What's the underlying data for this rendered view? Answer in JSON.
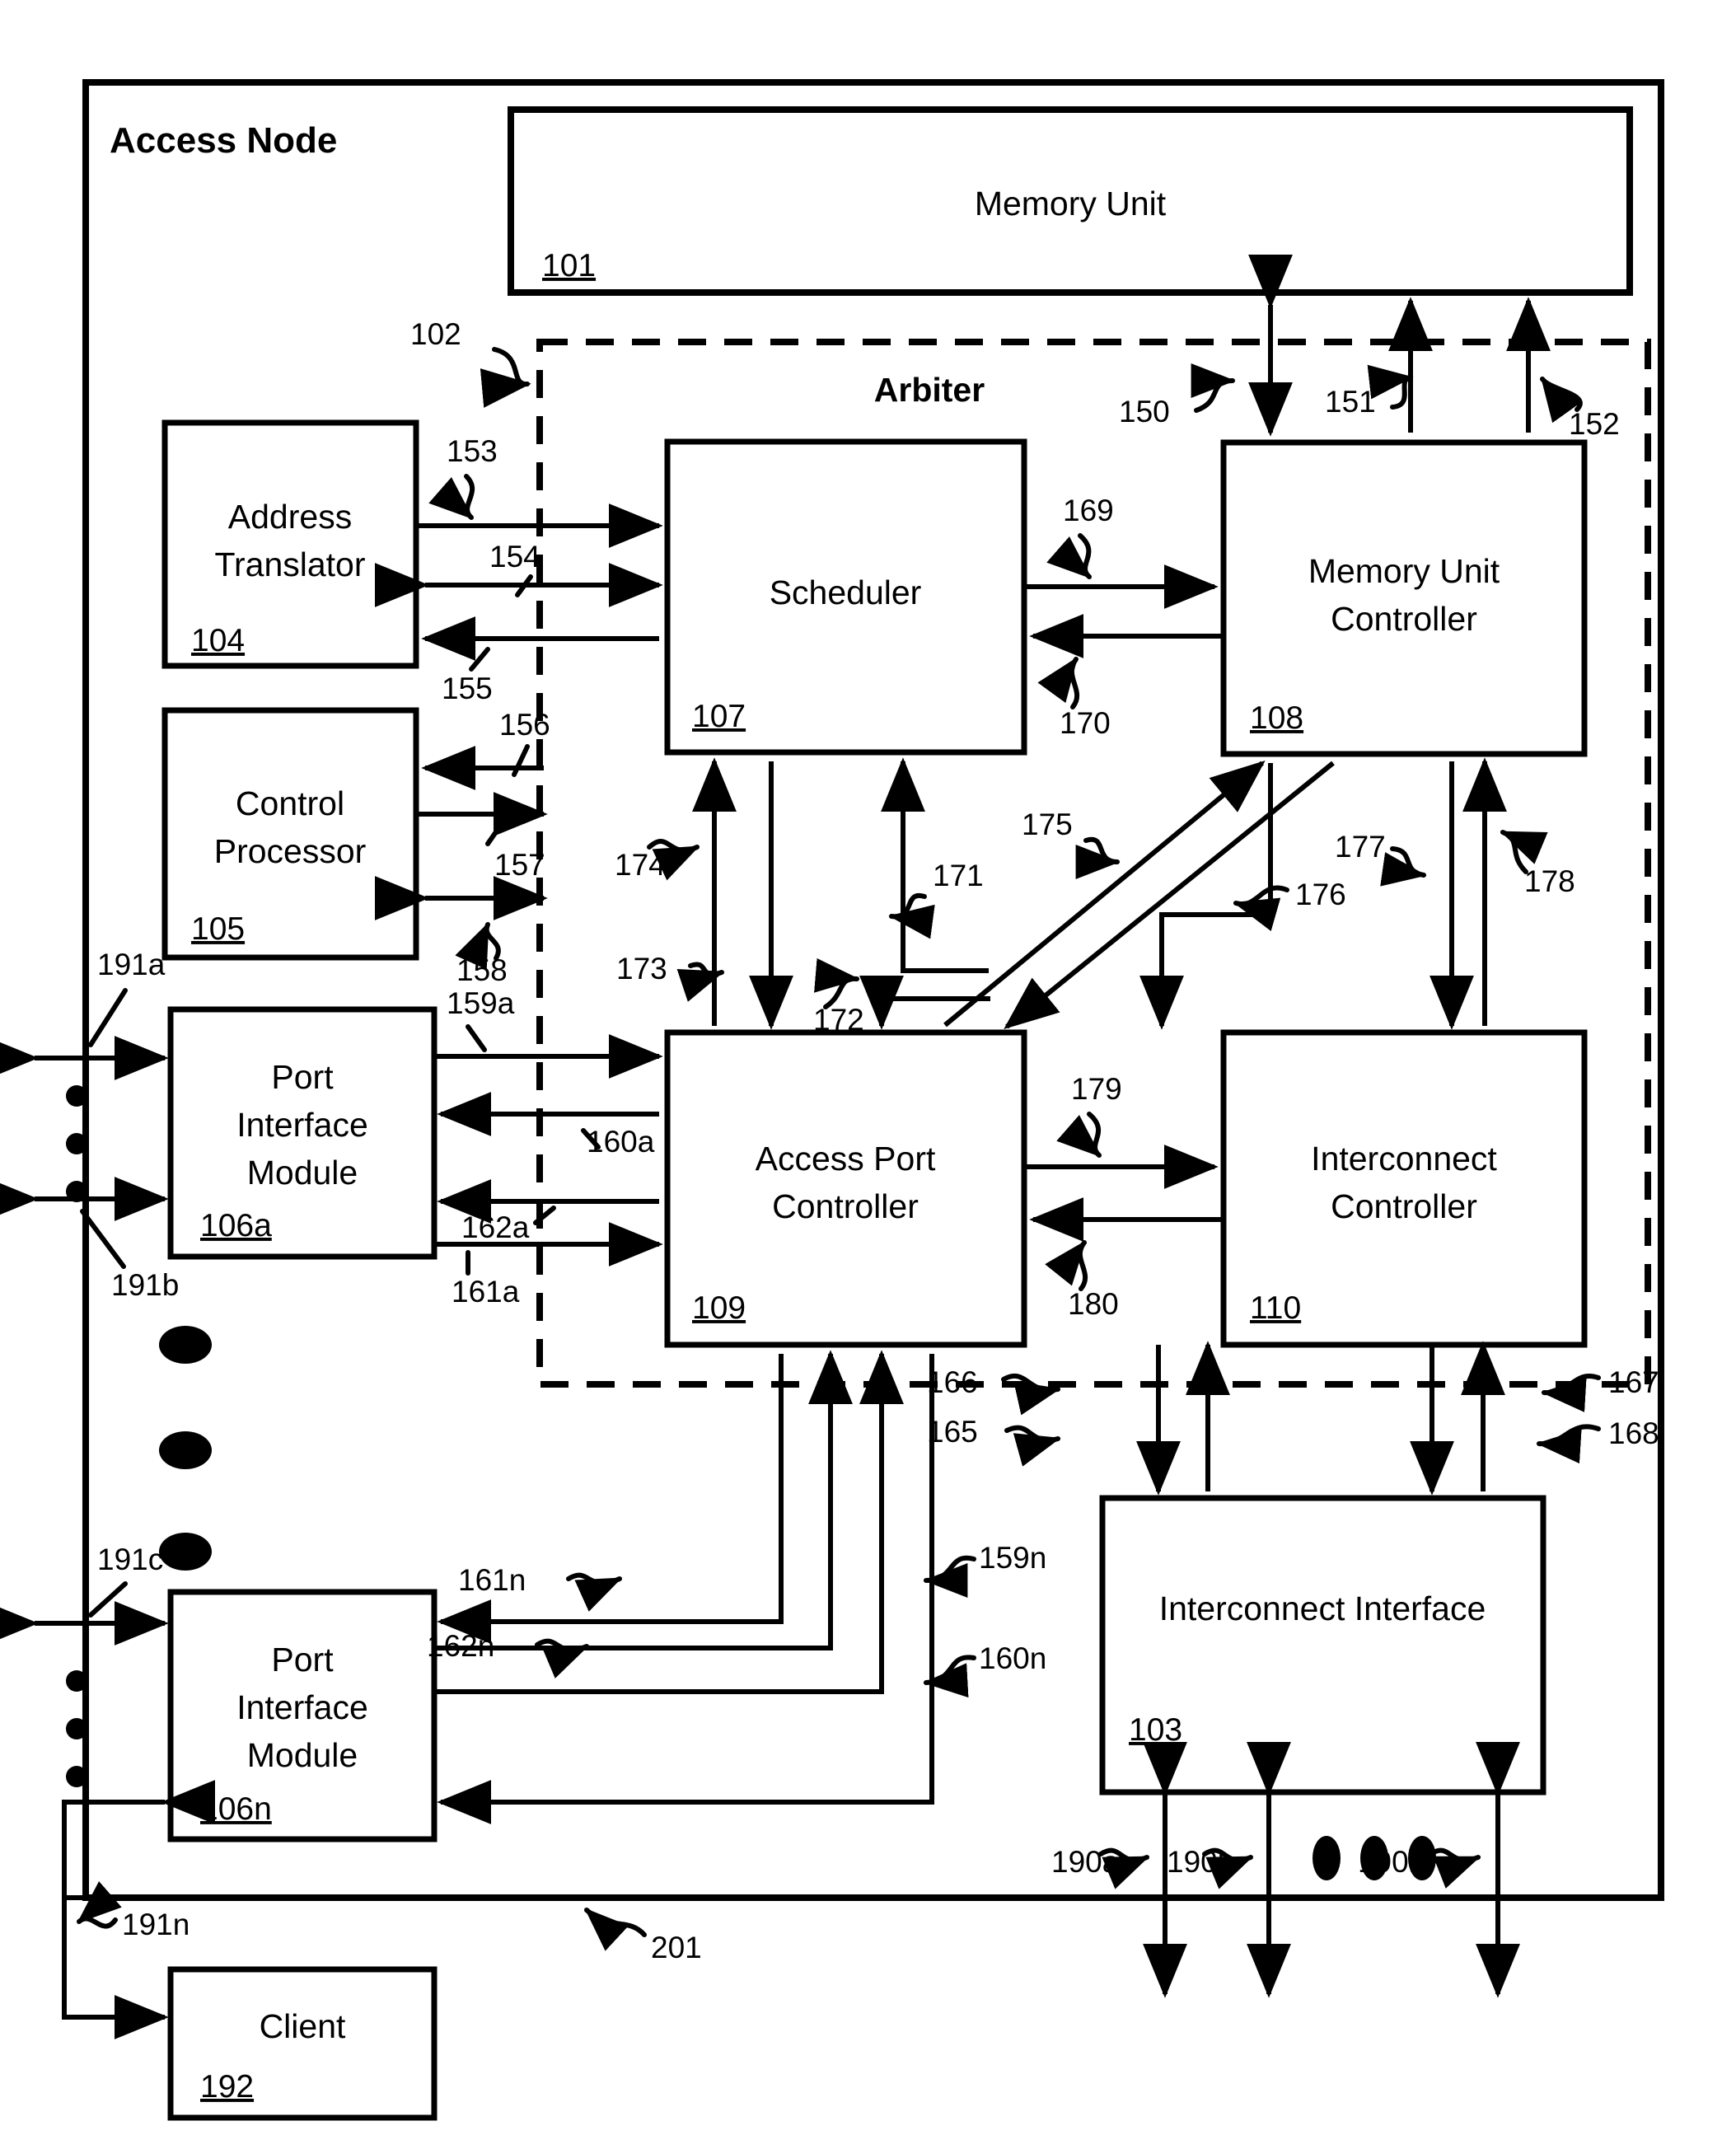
{
  "figure": {
    "title": "Access Node",
    "arbiter_label": "Arbiter",
    "background": "#ffffff",
    "line_color": "#000000"
  },
  "blocks": {
    "memory_unit": {
      "label": "Memory Unit",
      "ref": "101"
    },
    "arbiter": {
      "label": "Arbiter",
      "ref": "102"
    },
    "interconnect_interface": {
      "label": "Interconnect Interface",
      "ref": "103"
    },
    "address_translator": {
      "label_line1": "Address",
      "label_line2": "Translator",
      "ref": "104"
    },
    "control_processor": {
      "label_line1": "Control",
      "label_line2": "Processor",
      "ref": "105"
    },
    "port_interface_module_a": {
      "label_line1": "Port",
      "label_line2": "Interface",
      "label_line3": "Module",
      "ref": "106a"
    },
    "port_interface_module_n": {
      "label_line1": "Port",
      "label_line2": "Interface",
      "label_line3": "Module",
      "ref": "106n"
    },
    "scheduler": {
      "label": "Scheduler",
      "ref": "107"
    },
    "memory_unit_controller": {
      "label_line1": "Memory Unit",
      "label_line2": "Controller",
      "ref": "108"
    },
    "access_port_controller": {
      "label_line1": "Access Port",
      "label_line2": "Controller",
      "ref": "109"
    },
    "interconnect_controller": {
      "label_line1": "Interconnect",
      "label_line2": "Controller",
      "ref": "110"
    },
    "client": {
      "label": "Client",
      "ref": "192"
    }
  },
  "signals": {
    "s150": "150",
    "s151": "151",
    "s152": "152",
    "s153": "153",
    "s154": "154",
    "s155": "155",
    "s156": "156",
    "s157": "157",
    "s158": "158",
    "s159a": "159a",
    "s160a": "160a",
    "s161a": "161a",
    "s162a": "162a",
    "s159n": "159n",
    "s160n": "160n",
    "s161n": "161n",
    "s162n": "162n",
    "s165": "165",
    "s166": "166",
    "s167": "167",
    "s168": "168",
    "s169": "169",
    "s170": "170",
    "s171": "171",
    "s172": "172",
    "s173": "173",
    "s174": "174",
    "s175": "175",
    "s176": "176",
    "s177": "177",
    "s178": "178",
    "s179": "179",
    "s180": "180",
    "s190a": "190a",
    "s190b": "190b",
    "s190n": "190n",
    "s191a": "191a",
    "s191b": "191b",
    "s191c": "191c",
    "s191n": "191n",
    "s201": "201",
    "s102": "102"
  }
}
